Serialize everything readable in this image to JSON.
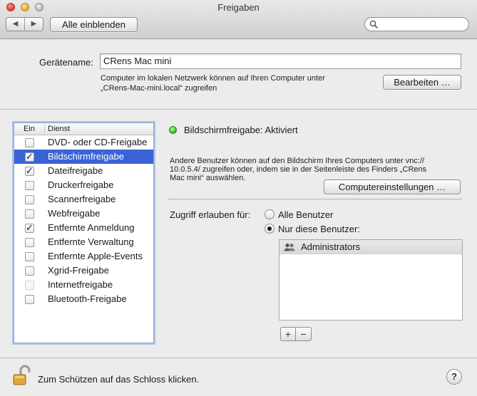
{
  "window": {
    "title": "Freigaben"
  },
  "toolbar": {
    "back_glyph": "◀",
    "forward_glyph": "▶",
    "show_all_label": "Alle einblenden",
    "search_placeholder": ""
  },
  "device": {
    "label": "Gerätename:",
    "value": "CRens Mac mini",
    "help_line1": "Computer im lokalen Netzwerk können auf Ihren Computer unter",
    "help_line2": "„CRens-Mac-mini.local“ zugreifen",
    "edit_label": "Bearbeiten …"
  },
  "services": {
    "header_on": "Ein",
    "header_service": "Dienst",
    "items": [
      {
        "label": "DVD- oder CD-Freigabe",
        "checked": false,
        "disabled": false,
        "selected": false
      },
      {
        "label": "Bildschirmfreigabe",
        "checked": true,
        "disabled": false,
        "selected": true
      },
      {
        "label": "Dateifreigabe",
        "checked": true,
        "disabled": false,
        "selected": false
      },
      {
        "label": "Druckerfreigabe",
        "checked": false,
        "disabled": false,
        "selected": false
      },
      {
        "label": "Scannerfreigabe",
        "checked": false,
        "disabled": false,
        "selected": false
      },
      {
        "label": "Webfreigabe",
        "checked": false,
        "disabled": false,
        "selected": false
      },
      {
        "label": "Entfernte Anmeldung",
        "checked": true,
        "disabled": false,
        "selected": false
      },
      {
        "label": "Entfernte Verwaltung",
        "checked": false,
        "disabled": false,
        "selected": false
      },
      {
        "label": "Entfernte Apple-Events",
        "checked": false,
        "disabled": false,
        "selected": false
      },
      {
        "label": "Xgrid-Freigabe",
        "checked": false,
        "disabled": false,
        "selected": false
      },
      {
        "label": "Internetfreigabe",
        "checked": false,
        "disabled": true,
        "selected": false
      },
      {
        "label": "Bluetooth-Freigabe",
        "checked": false,
        "disabled": false,
        "selected": false
      }
    ]
  },
  "detail": {
    "status": "Bildschirmfreigabe: Aktiviert",
    "status_color": "#3cc22a",
    "description_line1": "Andere Benutzer können auf den Bildschirm Ihres Computers unter vnc://",
    "description_line2": "10.0.5.4/ zugreifen oder, indem sie in der Seitenleiste des Finders „CRens",
    "description_line3": "Mac mini“ auswählen.",
    "computer_settings_label": "Computereinstellungen …",
    "access_label": "Zugriff erlauben für:",
    "option_all": "Alle Benutzer",
    "option_only": "Nur diese Benutzer:",
    "selected_option": "only",
    "users": [
      "Administrators"
    ],
    "add_label": "+",
    "remove_label": "−"
  },
  "footer": {
    "lock_text": "Zum Schützen auf das Schloss klicken.",
    "help_label": "?"
  },
  "colors": {
    "selection": "#3a63d6",
    "focus_ring": "#aac3e6"
  }
}
